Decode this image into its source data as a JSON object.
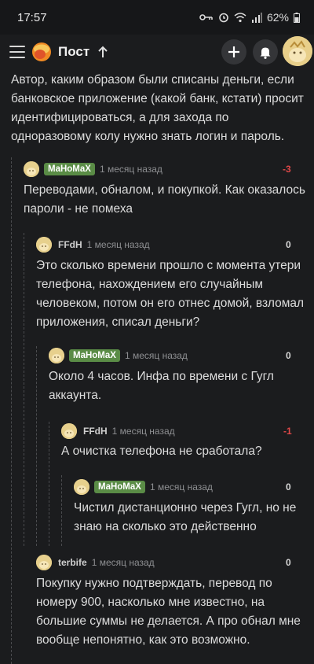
{
  "status_bar": {
    "time": "17:57",
    "battery": "62%"
  },
  "app_bar": {
    "title": "Пост"
  },
  "intro_text": "Автор, каким образом были списаны деньги, если банковское приложение (какой банк, кстати) просит идентифицироваться, а для захода по одноразовому колу нужно знать логин и пароль.",
  "comments": [
    {
      "author": "MaHoMaX",
      "badge": true,
      "time": "1 месяц назад",
      "rating": "-3",
      "text": "Переводами, обналом, и покупкой. Как оказалось пароли - не помеха"
    },
    {
      "author": "FFdH",
      "badge": false,
      "time": "1 месяц назад",
      "rating": "0",
      "text": "Это сколько времени прошло с момента утери телефона, нахождением его случайным человеком, потом он его отнес домой, взломал приложения, списал деньги?"
    },
    {
      "author": "MaHoMaX",
      "badge": true,
      "time": "1 месяц назад",
      "rating": "0",
      "text": "Около 4 часов. Инфа по времени с Гугл аккаунта."
    },
    {
      "author": "FFdH",
      "badge": false,
      "time": "1 месяц назад",
      "rating": "-1",
      "text": "А очистка телефона не сработала?"
    },
    {
      "author": "MaHoMaX",
      "badge": true,
      "time": "1 месяц назад",
      "rating": "0",
      "text": "Чистил дистанционно через Гугл, но не знаю на сколько это действенно"
    },
    {
      "author": "terbife",
      "badge": false,
      "time": "1 месяц назад",
      "rating": "0",
      "text": "Покупку нужно подтверждать, перевод по номеру 900, насколько мне известно, на большие суммы не делается. А про обнал мне вообще непонятно, как это возможно."
    }
  ],
  "colors": {
    "background": "#1b1c1e",
    "badge": "#5a8c46",
    "negative": "#e04848",
    "time": "#8e8f92"
  },
  "icons": [
    "menu-icon",
    "pikabu-logo",
    "arrow-up-icon",
    "plus-icon",
    "bell-icon",
    "avatar"
  ]
}
